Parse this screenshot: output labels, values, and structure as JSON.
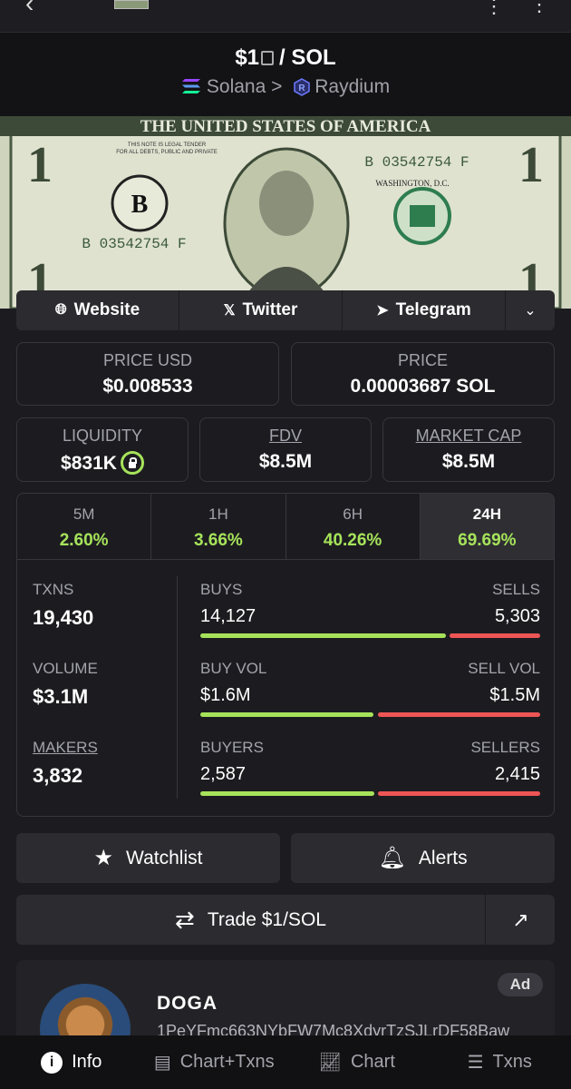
{
  "pair": {
    "title_base": "$1",
    "title_quote": "/ SOL",
    "chain": "Solana",
    "dex": "Raydium"
  },
  "banner": {
    "header_text": "THE UNITED STATES OF AMERICA",
    "legal_text_1": "THIS NOTE IS LEGAL TENDER",
    "legal_text_2": "FOR ALL DEBTS, PUBLIC AND PRIVATE",
    "serial": "B 03542754 F",
    "city": "WASHINGTON, D.C.",
    "seal_letter": "B",
    "denomination": "1"
  },
  "links": {
    "website": "Website",
    "twitter": "Twitter",
    "telegram": "Telegram"
  },
  "stats": {
    "price_usd_label": "PRICE USD",
    "price_usd": "$0.008533",
    "price_label": "PRICE",
    "price": "0.00003687 SOL",
    "liquidity_label": "LIQUIDITY",
    "liquidity": "$831K",
    "fdv_label": "FDV",
    "fdv": "$8.5M",
    "mcap_label": "MARKET CAP",
    "mcap": "$8.5M"
  },
  "timeframes": [
    {
      "label": "5M",
      "change": "2.60%"
    },
    {
      "label": "1H",
      "change": "3.66%"
    },
    {
      "label": "6H",
      "change": "40.26%"
    },
    {
      "label": "24H",
      "change": "69.69%"
    }
  ],
  "activity": {
    "txns_label": "TXNS",
    "txns": "19,430",
    "volume_label": "VOLUME",
    "volume": "$3.1M",
    "makers_label": "MAKERS",
    "makers": "3,832",
    "buys_label": "BUYS",
    "buys": "14,127",
    "sells_label": "SELLS",
    "sells": "5,303",
    "buy_ratio": 0.727,
    "buyvol_label": "BUY VOL",
    "buyvol": "$1.6M",
    "sellvol_label": "SELL VOL",
    "sellvol": "$1.5M",
    "buyvol_ratio": 0.516,
    "buyers_label": "BUYERS",
    "buyers": "2,587",
    "sellers_label": "SELLERS",
    "sellers": "2,415",
    "buyers_ratio": 0.517
  },
  "actions": {
    "watchlist": "Watchlist",
    "alerts": "Alerts",
    "trade": "Trade $1/SOL"
  },
  "ad": {
    "name": "DOGA",
    "address": "1PeYFmc663NYbFW7Mc8XdyrTzSJLrDF58Baw",
    "badge": "Ad"
  },
  "nav": {
    "info": "Info",
    "chart_txns": "Chart+Txns",
    "chart": "Chart",
    "txns": "Txns"
  },
  "colors": {
    "positive": "#a6e35a",
    "negative": "#ee5555",
    "background": "#1c1c20"
  }
}
